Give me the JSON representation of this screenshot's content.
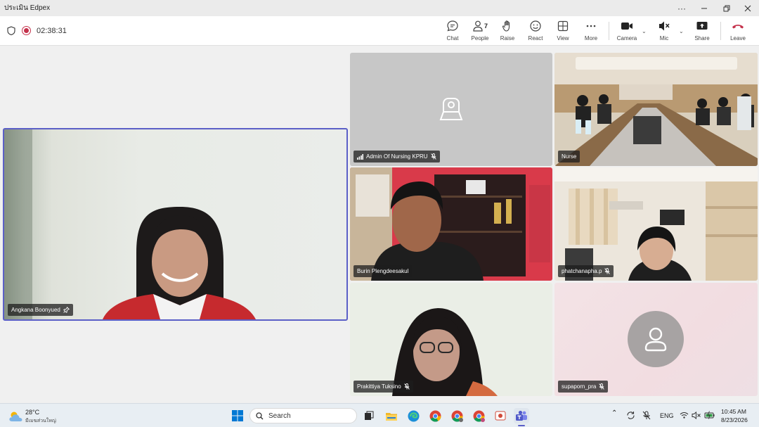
{
  "window": {
    "title": "ประเมิน Edpex"
  },
  "toolbar": {
    "timer": "02:38:31",
    "chat_label": "Chat",
    "people_label": "People",
    "people_count": "7",
    "raise_label": "Raise",
    "react_label": "React",
    "view_label": "View",
    "more_label": "More",
    "camera_label": "Camera",
    "mic_label": "Mic",
    "share_label": "Share",
    "leave_label": "Leave"
  },
  "participants": {
    "featured": {
      "name": "Angkana Boonyued",
      "pinned": true
    },
    "admin": {
      "name": "Admin Of Nursing KPRU",
      "muted": true
    },
    "nurse": {
      "name": "Nurse"
    },
    "burin": {
      "name": "Burin Plengdeesakul"
    },
    "phatchanapha": {
      "name": "phatchanapha.p",
      "muted": true
    },
    "prakittiya": {
      "name": "Prakittiya Tuksino",
      "muted": true
    },
    "supaporn": {
      "name": "supaporn_pra",
      "muted": true
    }
  },
  "taskbar": {
    "weather_temp": "28°C",
    "weather_desc": "มีเมฆส่วนใหญ่",
    "search_placeholder": "Search",
    "language": "ENG",
    "time": "10:45 AM",
    "date": "8/23/2026"
  },
  "colors": {
    "accent": "#5b5fc7",
    "record": "#c4314b",
    "leave": "#c4314b"
  }
}
